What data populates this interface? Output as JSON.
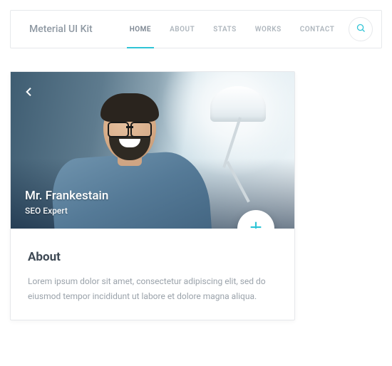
{
  "brand": "Meterial UI Kit",
  "nav": {
    "items": [
      "HOME",
      "ABOUT",
      "STATS",
      "WORKS",
      "CONTACT"
    ],
    "active_index": 0
  },
  "card": {
    "name": "Mr. Frankestain",
    "role": "SEO Expert",
    "section_title": "About",
    "section_text": "Lorem ipsum dolor sit amet, consectetur adipiscing elit, sed do eiusmod tempor incididunt ut labore et dolore magna aliqua."
  },
  "colors": {
    "accent": "#2fc4d6",
    "text_muted": "#9aa2aa",
    "heading": "#3f4a55"
  }
}
